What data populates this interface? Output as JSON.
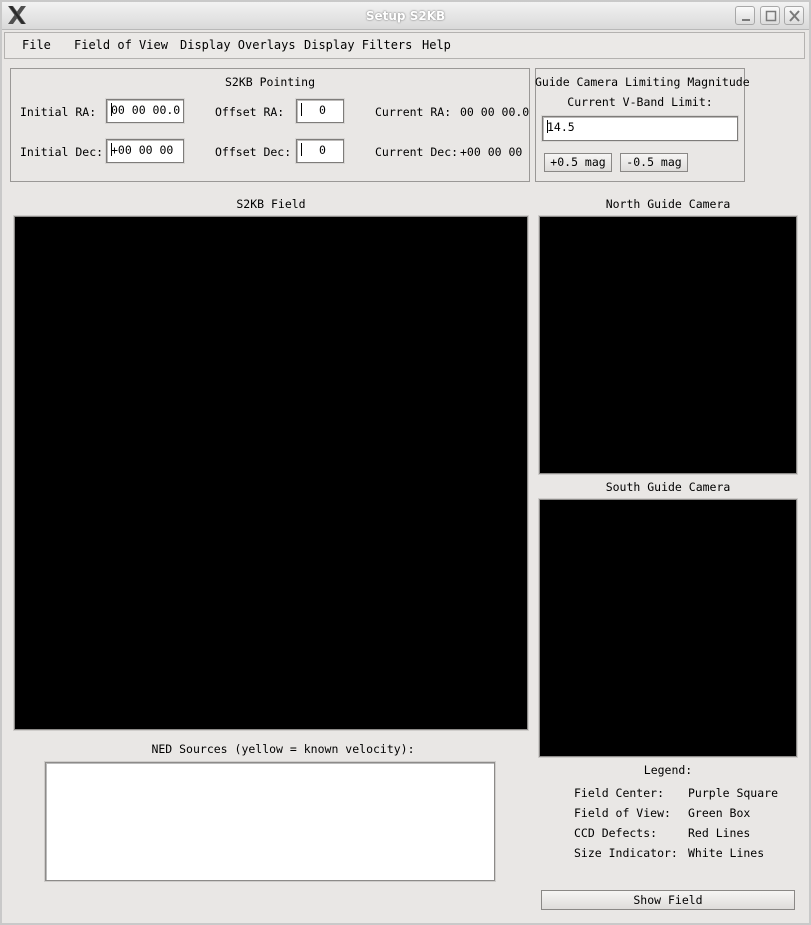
{
  "window": {
    "title": "Setup S2KB"
  },
  "menu": [
    "File",
    "Field of View",
    "Display Overlays",
    "Display Filters",
    "Help"
  ],
  "pointing": {
    "title": "S2KB Pointing",
    "initial_ra_label": "Initial RA:",
    "initial_ra_value": "00 00 00.0",
    "initial_dec_label": "Initial Dec:",
    "initial_dec_value": "+00 00 00",
    "offset_ra_label": "Offset RA:",
    "offset_ra_value": "0",
    "offset_dec_label": "Offset Dec:",
    "offset_dec_value": "0",
    "current_ra_label": "Current RA:",
    "current_ra_value": "00 00 00.0",
    "current_dec_label": "Current Dec:",
    "current_dec_value": "+00 00 00"
  },
  "guide_limit": {
    "title": "Guide Camera Limiting Magnitude",
    "sublabel": "Current V-Band Limit:",
    "value": "14.5",
    "plus_button": "+0.5 mag",
    "minus_button": "-0.5 mag"
  },
  "panels": {
    "main_field": "S2KB Field",
    "north_guide": "North Guide Camera",
    "south_guide": "South Guide Camera",
    "ned_sources": "NED Sources (yellow = known velocity):"
  },
  "legend": {
    "title": "Legend:",
    "rows": [
      {
        "key": "Field Center:",
        "value": "Purple Square"
      },
      {
        "key": "Field of View:",
        "value": "Green Box"
      },
      {
        "key": "CCD Defects:",
        "value": "Red Lines"
      },
      {
        "key": "Size Indicator:",
        "value": "White Lines"
      }
    ]
  },
  "show_field_button": "Show Field"
}
